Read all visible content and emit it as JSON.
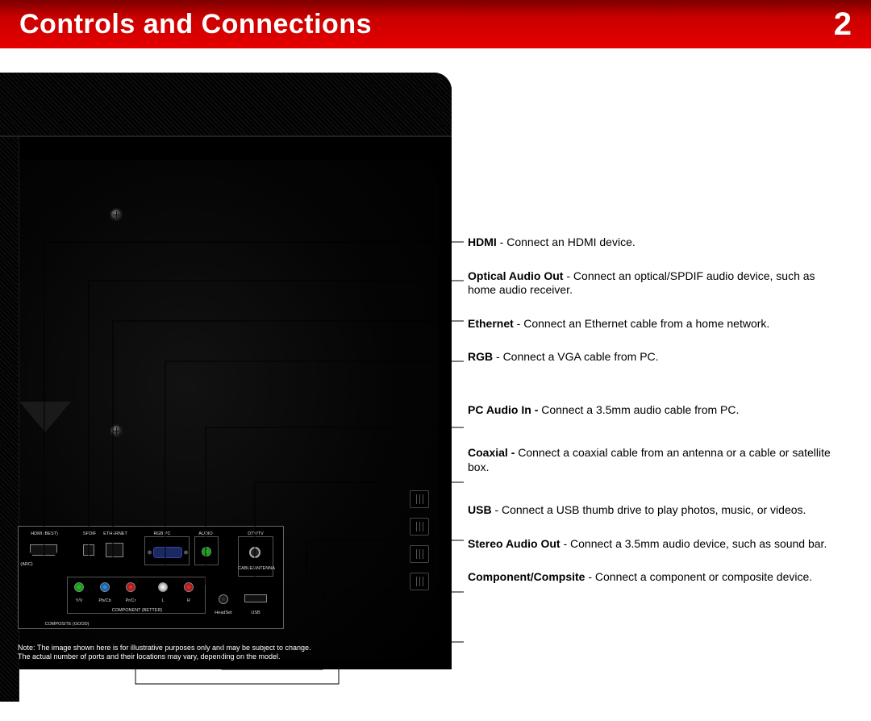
{
  "header": {
    "title": "Controls and Connections",
    "chapter": "2"
  },
  "port_labels": {
    "hdmi": "HDMI (BEST)",
    "arc": "(ARC)",
    "spdif": "SPDIF",
    "ethernet": "ETHERNET",
    "rgbpc": "RGB PC",
    "audio": "AUDIO",
    "dtv": "DTV/TV",
    "cable": "CABLE/ANTENNA",
    "ypbpr_y": "Y/V",
    "ypbpr_pb": "Pb/Cb",
    "ypbpr_pr": "Pr/Cr",
    "l": "L",
    "r": "R",
    "component": "COMPONENT (BETTER)",
    "composite": "COMPOSITE (GOOD)",
    "headset": "HeadSet",
    "usb": "USB"
  },
  "descriptions": [
    {
      "label": "HDMI",
      "text": " - Connect an HDMI device."
    },
    {
      "label": "Optical Audio Out",
      "text": " - Connect an optical/SPDIF audio device, such as home audio receiver."
    },
    {
      "label": "Ethernet",
      "text": " - Connect an Ethernet cable from a home network."
    },
    {
      "label": "RGB",
      "text": " - Connect a VGA cable from PC."
    },
    {
      "label": "PC Audio In - ",
      "text": "Connect a 3.5mm audio cable from PC."
    },
    {
      "label": "Coaxial - ",
      "text": "Connect a coaxial cable from an antenna or a cable or satellite box."
    },
    {
      "label": "USB",
      "text": " - Connect a USB thumb drive to play photos, music, or videos."
    },
    {
      "label": "Stereo Audio Out",
      "text": " - Connect a 3.5mm audio device, such as sound bar."
    },
    {
      "label": "Component/Compsite",
      "text": " - Connect a component or composite device."
    }
  ],
  "note": {
    "line1": "Note:  The image shown here is for illustrative purposes only and may be subject to change.",
    "line2": "The actual number of ports and their locations may vary, depending on the model."
  }
}
